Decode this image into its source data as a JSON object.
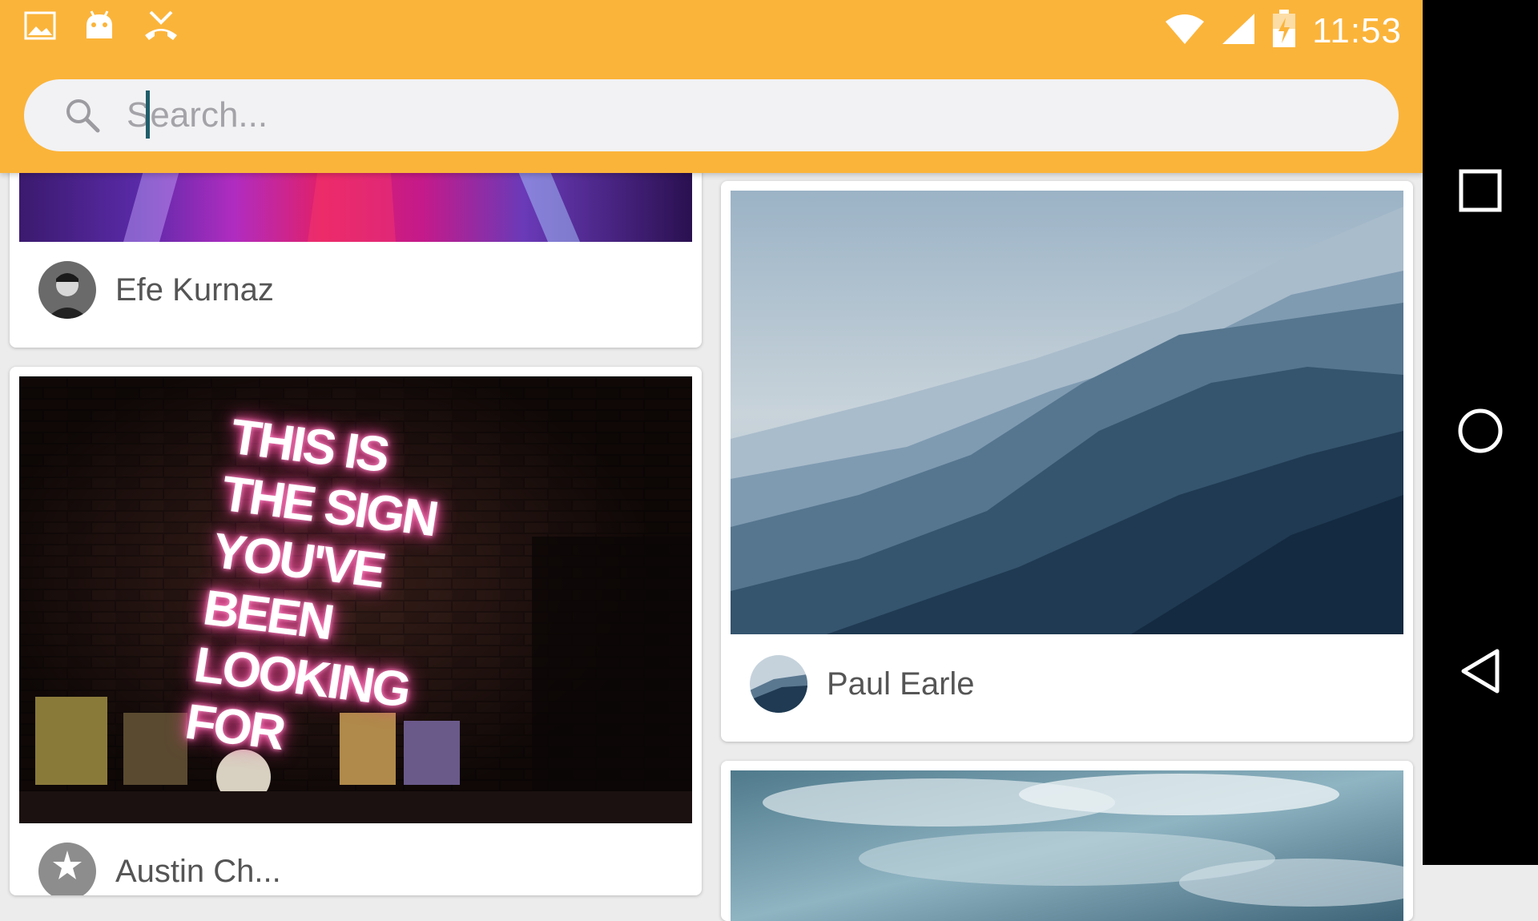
{
  "status_bar": {
    "time": "11:53",
    "left_icons": [
      "gallery-icon",
      "android-debug-icon",
      "missed-call-icon"
    ],
    "right_icons": [
      "wifi-icon",
      "cell-signal-icon",
      "battery-charging-icon"
    ]
  },
  "search": {
    "placeholder": "Search...",
    "value": ""
  },
  "cards": [
    {
      "author": "Efe Kurnaz",
      "photo": "neon-stage-lights"
    },
    {
      "author": "Paul Earle",
      "photo": "misty-mountains"
    },
    {
      "author": "Austin Ch...",
      "photo": "neon-sign",
      "sign_text": "THIS IS\nTHE SIGN\nYOU'VE BEEN\nLOOKING FOR"
    },
    {
      "author": "",
      "photo": "cloudy-sky"
    }
  ],
  "nav_bar": {
    "buttons": [
      "recents-button",
      "home-button",
      "back-button"
    ]
  },
  "colors": {
    "accent": "#fbb43a",
    "search_bg": "#f2f2f4",
    "nav_bg": "#000000"
  }
}
